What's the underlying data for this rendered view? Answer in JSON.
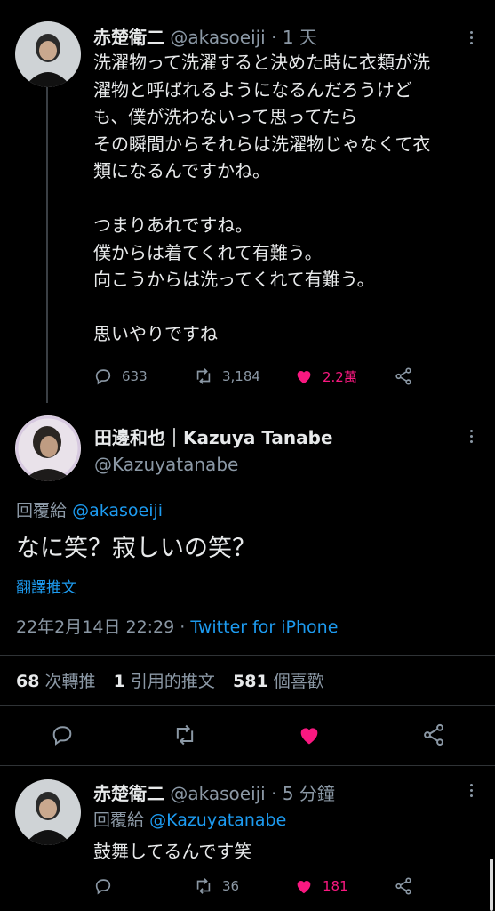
{
  "tweet1": {
    "display_name": "赤楚衛二",
    "handle": "@akasoeiji",
    "dot": "·",
    "time": "1 天",
    "text": "洗濯物って洗濯すると決めた時に衣類が洗\n濯物と呼ばれるようになるんだろうけど\nも、僕が洗わないって思ってたら\nその瞬間からそれらは洗濯物じゃなくて衣\n類になるんですかね。\n\nつまりあれですね。\n僕からは着てくれて有難う。\n向こうからは洗ってくれて有難う。\n\n思いやりですね",
    "replies": "633",
    "retweets": "3,184",
    "likes": "2.2萬"
  },
  "main_tweet": {
    "display_name": "田邊和也｜Kazuya Tanabe",
    "handle": "@Kazuyatanabe",
    "reply_prefix": "回覆給",
    "reply_to": "@akasoeiji",
    "text": "なに笑？寂しいの笑？",
    "translate": "翻譯推文",
    "timestamp": "22年2月14日 22:29",
    "dot": "·",
    "source": "Twitter for iPhone",
    "retweet_count": "68",
    "retweet_label": "次轉推",
    "quote_count": "1",
    "quote_label": "引用的推文",
    "like_count": "581",
    "like_label": "個喜歡"
  },
  "tweet3": {
    "display_name": "赤楚衛二",
    "handle": "@akasoeiji",
    "dot": "·",
    "time": "5 分鐘",
    "reply_prefix": "回覆給",
    "reply_to": "@Kazuyatanabe",
    "text": "鼓舞してるんです笑",
    "retweets": "36",
    "likes": "181"
  },
  "colors": {
    "background": "#000000",
    "text": "#e7e9ea",
    "muted": "#8b98a5",
    "link": "#1d9bf0",
    "like": "#f91880"
  },
  "icons": [
    "reply-icon",
    "retweet-icon",
    "heart-icon",
    "share-icon",
    "more-icon"
  ]
}
